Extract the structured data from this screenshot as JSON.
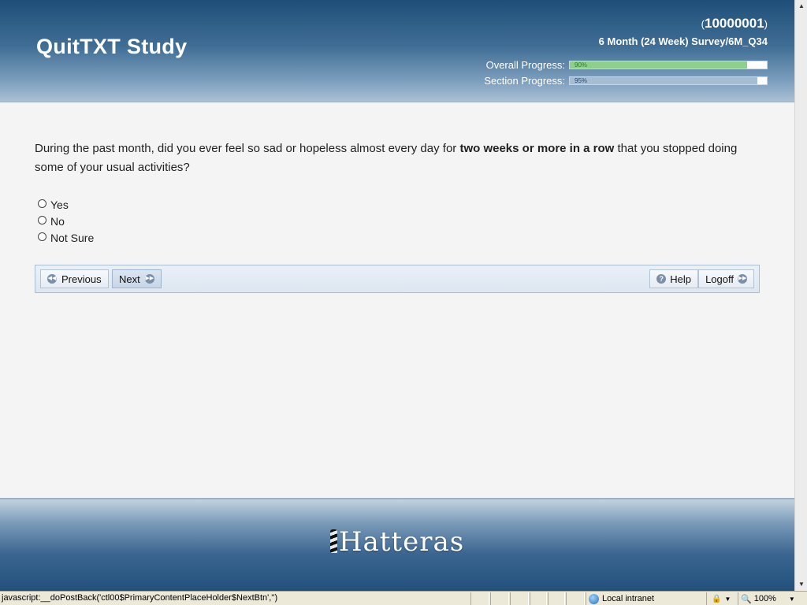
{
  "header": {
    "study_title": "QuitTXT Study",
    "user_id_open": "(",
    "user_id": "10000001",
    "user_id_close": ")",
    "survey_name": "6 Month (24 Week) Survey/6M_Q34",
    "overall_progress": {
      "label": "Overall Progress:",
      "percent_text": "90%",
      "fraction": 0.9
    },
    "section_progress": {
      "label": "Section Progress:",
      "percent_text": "95%",
      "fraction": 0.95
    }
  },
  "question": {
    "text_before": "During the past month, did you ever feel so sad or hopeless almost every day for ",
    "text_bold": "two weeks or more in a row",
    "text_after": " that you stopped doing some of your usual activities?"
  },
  "options": [
    {
      "label": "Yes"
    },
    {
      "label": "No"
    },
    {
      "label": "Not Sure"
    }
  ],
  "nav": {
    "previous_label": "Previous",
    "next_label": "Next",
    "help_label": "Help",
    "logoff_label": "Logoff"
  },
  "footer": {
    "logo_text": "Hatteras"
  },
  "status_bar": {
    "text": "javascript:__doPostBack('ctl00$PrimaryContentPlaceHolder$NextBtn','')",
    "zone": "Local intranet",
    "zoom": "100%"
  },
  "icons": {
    "previous": "rewind-circle-icon",
    "next": "fast-forward-circle-icon",
    "help": "question-circle-icon",
    "logoff": "fast-forward-circle-icon",
    "logo": "lighthouse-icon",
    "zone": "globe-icon",
    "zoom": "magnifier-icon"
  },
  "colors": {
    "header_blue": "#1f4f79",
    "overall_fill": "#8fcf8c",
    "section_fill": "#a7bdd1"
  }
}
